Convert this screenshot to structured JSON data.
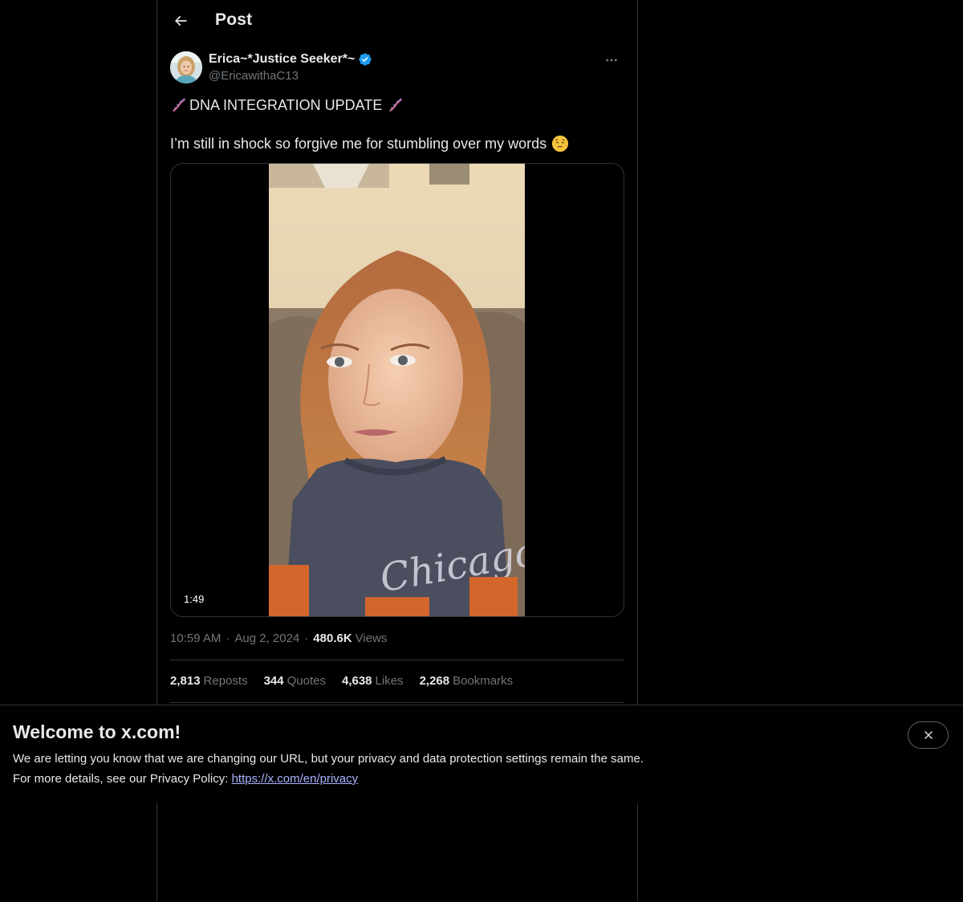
{
  "header": {
    "title": "Post"
  },
  "author": {
    "name": "Erica~*Justice Seeker*~",
    "handle": "@EricawithaC13",
    "verified": true
  },
  "post": {
    "line1_icon": "dna-emoji",
    "line1_text": "DNA INTEGRATION UPDATE",
    "line2_text": "I’m still in shock so forgive me for stumbling over my words",
    "line2_icon": "pensive-face-emoji"
  },
  "media": {
    "duration": "1:49",
    "shirt_text": "Chicago"
  },
  "meta": {
    "time": "10:59 AM",
    "separator": "·",
    "date": "Aug 2, 2024",
    "views_count": "480.6K",
    "views_label": "Views"
  },
  "stats": {
    "reposts_count": "2,813",
    "reposts_label": "Reposts",
    "quotes_count": "344",
    "quotes_label": "Quotes",
    "likes_count": "4,638",
    "likes_label": "Likes",
    "bookmarks_count": "2,268",
    "bookmarks_label": "Bookmarks"
  },
  "banner": {
    "title": "Welcome to x.com!",
    "line1": "We are letting you know that we are changing our URL, but your privacy and data protection settings remain the same.",
    "line2_prefix": "For more details, see our Privacy Policy: ",
    "link": "https://x.com/en/privacy"
  },
  "colors": {
    "background": "#000000",
    "text_primary": "#e7e9ea",
    "text_secondary": "#71767b",
    "border": "#2f3336",
    "verified_blue": "#1d9bf0",
    "link": "#aab2ff"
  }
}
